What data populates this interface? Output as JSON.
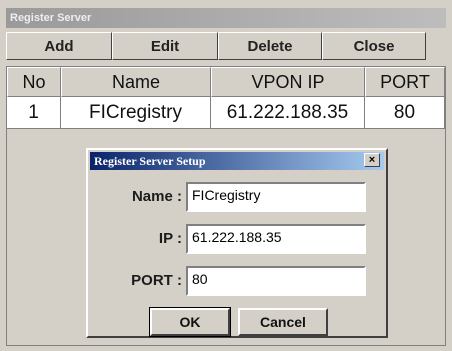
{
  "window": {
    "title": "Register Server"
  },
  "toolbar": {
    "add": "Add",
    "edit": "Edit",
    "delete": "Delete",
    "close": "Close"
  },
  "table": {
    "headers": {
      "no": "No",
      "name": "Name",
      "ip": "VPON IP",
      "port": "PORT"
    },
    "rows": [
      {
        "no": "1",
        "name": "FICregistry",
        "ip": "61.222.188.35",
        "port": "80"
      }
    ]
  },
  "dialog": {
    "title": "Register Server Setup",
    "name_label": "Name :",
    "name_value": "FICregistry",
    "ip_label": "IP :",
    "ip_value": "61.222.188.35",
    "port_label": "PORT :",
    "port_value": "80",
    "ok": "OK",
    "cancel": "Cancel",
    "close_glyph": "×"
  }
}
